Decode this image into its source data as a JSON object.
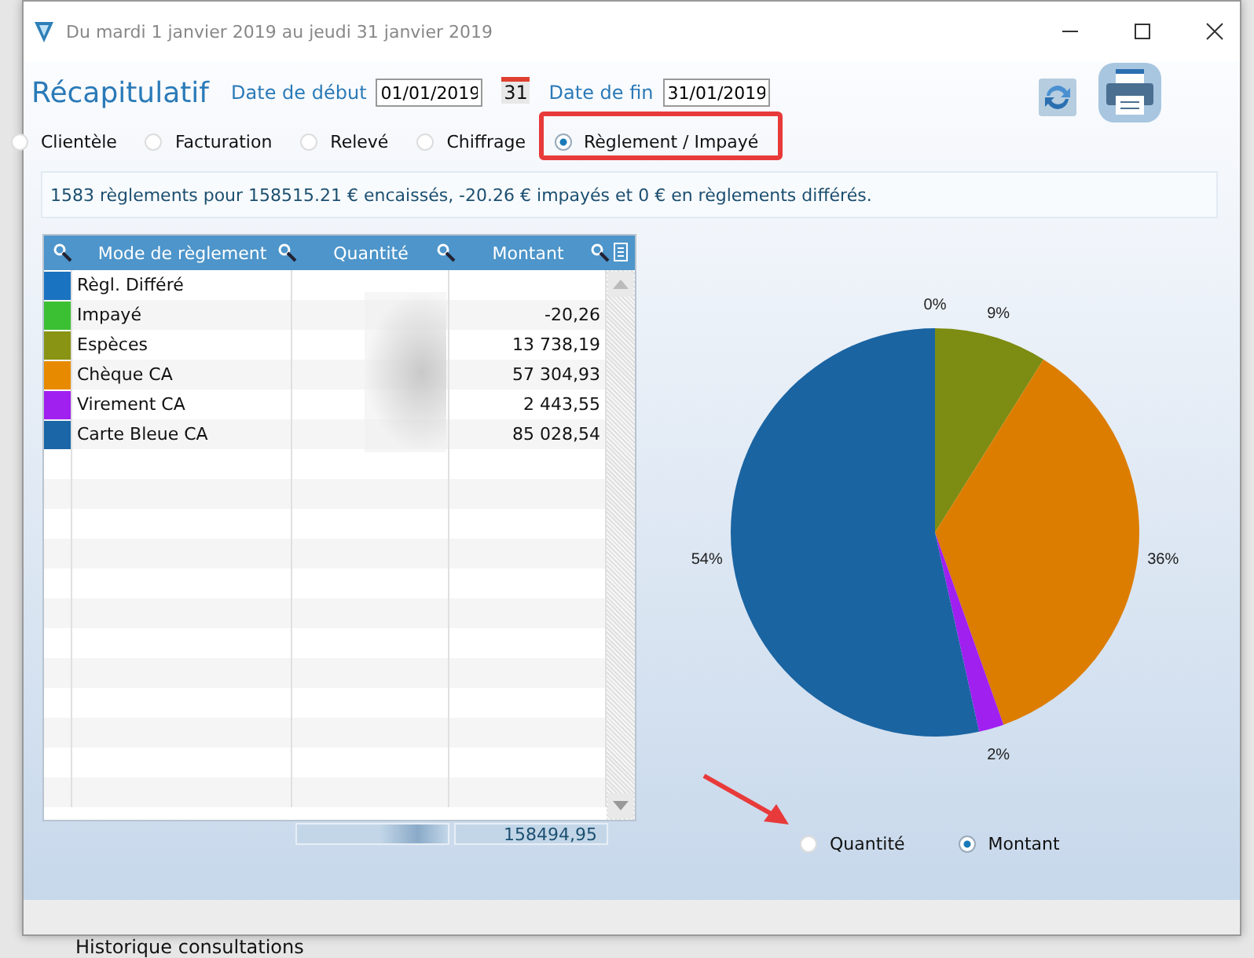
{
  "window": {
    "title": "Du mardi 1 janvier 2019 au jeudi 31 janvier 2019"
  },
  "header": {
    "title": "Récapitulatif",
    "start_label": "Date de début",
    "start_value": "01/01/2019",
    "calendar_day": "31",
    "end_label": "Date de fin",
    "end_value": "31/01/2019"
  },
  "report_types": [
    {
      "label": "Clientèle",
      "selected": false
    },
    {
      "label": "Facturation",
      "selected": false
    },
    {
      "label": "Relevé",
      "selected": false
    },
    {
      "label": "Chiffrage",
      "selected": false
    },
    {
      "label": "Règlement / Impayé",
      "selected": true
    }
  ],
  "summary": "1583 règlements pour 158515.21 € encaissés, -20.26 € impayés et 0 € en règlements différés.",
  "table": {
    "columns": [
      "Mode de règlement",
      "Quantité",
      "Montant"
    ],
    "rows": [
      {
        "color": "#1a73c0",
        "mode": "Règl. Différé",
        "montant": ""
      },
      {
        "color": "#3cc033",
        "mode": "Impayé",
        "montant": "-20,26"
      },
      {
        "color": "#8a9414",
        "mode": "Espèces",
        "montant": "13 738,19"
      },
      {
        "color": "#e88a00",
        "mode": "Chèque CA",
        "montant": "57 304,93"
      },
      {
        "color": "#a020f0",
        "mode": "Virement CA",
        "montant": "2 443,55"
      },
      {
        "color": "#1a66a6",
        "mode": "Carte Bleue CA",
        "montant": "85 028,54"
      }
    ],
    "total_montant": "158494,95"
  },
  "chart_data": {
    "type": "pie",
    "values": [
      0,
      9,
      36,
      2,
      54
    ],
    "colors": [
      "#1a73c0",
      "#7d8c12",
      "#dc7d00",
      "#a020f0",
      "#1a64a2"
    ],
    "value_labels": [
      "0%",
      "9%",
      "36%",
      "2%",
      "54%"
    ]
  },
  "chart_modes": [
    {
      "label": "Quantité",
      "selected": false
    },
    {
      "label": "Montant",
      "selected": true
    }
  ],
  "background_app": {
    "label": "Historique consultations"
  }
}
